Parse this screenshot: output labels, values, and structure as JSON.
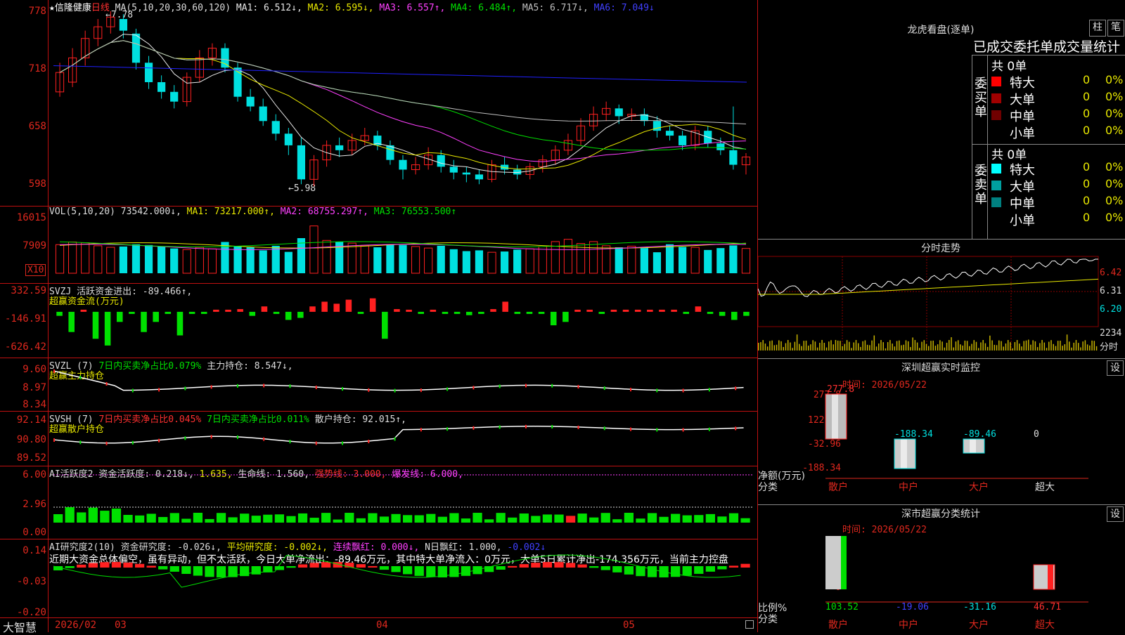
{
  "stock": {
    "name": "★信隆健康",
    "period": "日线"
  },
  "main_legend": {
    "ma": "MA(5,10,20,30,60,120)",
    "items": [
      {
        "label": "MA1: 6.512↓,",
        "color": "#e8e8e8"
      },
      {
        "label": "MA2: 6.595↓,",
        "color": "#e8e800"
      },
      {
        "label": "MA3: 6.557↑,",
        "color": "#ff40ff"
      },
      {
        "label": "MA4: 6.484↑,",
        "color": "#00e000"
      },
      {
        "label": "MA5: 6.717↓,",
        "color": "#c0c0c0"
      },
      {
        "label": "MA6: 7.049↓",
        "color": "#2020ff"
      }
    ],
    "high_mark": "7.78",
    "low_mark": "5.98"
  },
  "price_axis": [
    "778",
    "718",
    "658",
    "598"
  ],
  "colors": {
    "up": "#ff2020",
    "down": "#00e0e0",
    "axis": "#e0281e",
    "frame": "#c01010"
  },
  "vol": {
    "legend_prefix": "VOL(5,10,20)",
    "value": "73542.000↓,",
    "ma1": "MA1: 73217.000↑,",
    "ma2": "MA2: 68755.297↑,",
    "ma3": "MA3: 76553.500↑",
    "axis": [
      "16015",
      "7909"
    ],
    "unit": "X10"
  },
  "svzj": {
    "line1_prefix": "SVZJ",
    "line1_label": "活跃资金进出:",
    "line1_value": "-89.466↑,",
    "line2": "超赢资金流(万元)",
    "axis": [
      "332.59",
      "-146.91",
      "-626.42"
    ]
  },
  "svzl": {
    "prefix": "SVZL (7)",
    "ratio": "7日内买卖净占比0.079%",
    "hold": "主力持仓: 8.547↓,",
    "line2": "超赢主力持仓",
    "axis": [
      "9.60",
      "8.97",
      "8.34"
    ]
  },
  "svsh": {
    "prefix": "SVSH (7)",
    "ratio1": "7日内买卖净占比0.045%",
    "ratio2": "7日内买卖净占比0.011%",
    "hold": "散户持仓: 92.015↑,",
    "line2": "超赢散户持仓",
    "axis": [
      "92.14",
      "90.80",
      "89.52"
    ]
  },
  "ai_active": {
    "prefix": "AI活跃度2",
    "label": "资金活跃度: 0.218↓,",
    "v2": "1.635,",
    "life": "生命线: 1.560,",
    "strong": "强势线: 3.000,",
    "burst": "爆发线: 6.000,",
    "axis": [
      "6.00",
      "2.96",
      "0.00"
    ]
  },
  "ai_research": {
    "prefix": "AI研究度2(10)",
    "label": "资金研究度: -0.026↓,",
    "avg": "平均研究度: -0.002↓,",
    "streak": "连续飘红: 0.000↓,",
    "nday": "N日飘红: 1.000,",
    "last": "-0.002↓",
    "comment": "近期大资金总体偏空，虽有异动，但不太活跃，今日大单净流出：-89.46万元，其中特大单净流入：0万元，大单5日累计净出-174.356万元，当前主力控盘",
    "axis": [
      "0.14",
      "-0.03",
      "-0.20"
    ]
  },
  "date_axis": {
    "brand": "大智慧",
    "labels": [
      "2026/02",
      "03",
      "04",
      "05"
    ]
  },
  "dragon": {
    "title": "龙虎看盘(逐单)",
    "btn1": "柱",
    "btn2": "笔",
    "header": "已成交委托单成交量统计",
    "buy_side": "委买单",
    "sell_side": "委卖单",
    "buy_total": "共 0单",
    "sell_total": "共 0单",
    "buy_rows": [
      {
        "label": "特大",
        "count": "0",
        "pct": "0%",
        "color": "#ff0000"
      },
      {
        "label": "大单",
        "count": "0",
        "pct": "0%",
        "color": "#a00000"
      },
      {
        "label": "中单",
        "count": "0",
        "pct": "0%",
        "color": "#700000"
      },
      {
        "label": "小单",
        "count": "0",
        "pct": "0%",
        "color": "#000000"
      }
    ],
    "sell_rows": [
      {
        "label": "特大",
        "count": "0",
        "pct": "0%",
        "color": "#00ffff"
      },
      {
        "label": "大单",
        "count": "0",
        "pct": "0%",
        "color": "#00a0a0"
      },
      {
        "label": "中单",
        "count": "0",
        "pct": "0%",
        "color": "#008080"
      },
      {
        "label": "小单",
        "count": "0",
        "pct": "0%",
        "color": "#000000"
      }
    ]
  },
  "intraday": {
    "title": "分时走势",
    "price_axis": [
      "6.42",
      "6.31",
      "6.20"
    ],
    "vol_axis": "2234",
    "vol_label": "分时"
  },
  "sz_monitor": {
    "title": "深圳超赢实时监控",
    "setting": "设",
    "time": "时间: 2026/05/22",
    "axis": [
      "277.8",
      "122.42",
      "-32.96",
      "-188.34"
    ],
    "ylabel": "净额(万元)",
    "xlabel": "分类",
    "categories": [
      "散户",
      "中户",
      "大户",
      "超大"
    ],
    "value_labels": [
      "277.8",
      "-188.34",
      "-89.46",
      "0"
    ]
  },
  "sz_class": {
    "title": "深市超赢分类统计",
    "setting": "设",
    "time": "时间: 2026/05/22",
    "axis": [
      "75",
      "50",
      "25",
      "0"
    ],
    "ylabel": "比例%",
    "xlabel": "分类",
    "categories": [
      "散户",
      "中户",
      "大户",
      "超大"
    ],
    "value_labels": [
      "103.52",
      "-19.06",
      "-31.16",
      "46.71"
    ]
  },
  "chart_data": [
    {
      "type": "candlestick",
      "name": "日线",
      "ylim": [
        5.98,
        7.78
      ],
      "candles": [
        [
          6.95,
          7.15,
          7.25,
          6.9
        ],
        [
          7.05,
          7.3,
          7.4,
          7.0
        ],
        [
          7.3,
          7.5,
          7.58,
          7.22
        ],
        [
          7.5,
          7.62,
          7.7,
          7.42
        ],
        [
          7.62,
          7.72,
          7.78,
          7.55
        ],
        [
          7.7,
          7.58,
          7.75,
          7.5
        ],
        [
          7.55,
          7.25,
          7.6,
          7.18
        ],
        [
          7.25,
          7.05,
          7.32,
          6.98
        ],
        [
          7.05,
          6.95,
          7.12,
          6.88
        ],
        [
          6.95,
          6.85,
          7.02,
          6.78
        ],
        [
          6.85,
          7.1,
          7.15,
          6.8
        ],
        [
          7.1,
          7.3,
          7.38,
          7.05
        ],
        [
          7.3,
          7.4,
          7.45,
          7.22
        ],
        [
          7.4,
          7.2,
          7.45,
          7.15
        ],
        [
          7.2,
          6.9,
          7.25,
          6.85
        ],
        [
          6.9,
          6.8,
          6.98,
          6.75
        ],
        [
          6.8,
          6.65,
          6.88,
          6.6
        ],
        [
          6.65,
          6.52,
          6.72,
          6.45
        ],
        [
          6.52,
          6.4,
          6.58,
          6.3
        ],
        [
          6.4,
          6.05,
          6.48,
          6.0
        ],
        [
          6.05,
          6.25,
          6.3,
          5.98
        ],
        [
          6.25,
          6.4,
          6.45,
          6.18
        ],
        [
          6.4,
          6.35,
          6.48,
          6.28
        ],
        [
          6.35,
          6.45,
          6.52,
          6.3
        ],
        [
          6.45,
          6.5,
          6.58,
          6.4
        ],
        [
          6.5,
          6.4,
          6.55,
          6.35
        ],
        [
          6.4,
          6.25,
          6.45,
          6.2
        ],
        [
          6.25,
          6.15,
          6.3,
          6.05
        ],
        [
          6.15,
          6.2,
          6.28,
          6.1
        ],
        [
          6.2,
          6.3,
          6.38,
          6.15
        ],
        [
          6.3,
          6.18,
          6.35,
          6.12
        ],
        [
          6.18,
          6.12,
          6.25,
          6.05
        ],
        [
          6.12,
          6.1,
          6.18,
          6.02
        ],
        [
          6.1,
          6.05,
          6.15,
          6.0
        ],
        [
          6.05,
          6.2,
          6.25,
          6.02
        ],
        [
          6.2,
          6.15,
          6.28,
          6.1
        ],
        [
          6.15,
          6.1,
          6.2,
          6.05
        ],
        [
          6.1,
          6.18,
          6.22,
          6.05
        ],
        [
          6.18,
          6.25,
          6.3,
          6.12
        ],
        [
          6.25,
          6.35,
          6.4,
          6.2
        ],
        [
          6.35,
          6.45,
          6.52,
          6.3
        ],
        [
          6.45,
          6.6,
          6.68,
          6.4
        ],
        [
          6.6,
          6.72,
          6.8,
          6.55
        ],
        [
          6.72,
          6.78,
          6.85,
          6.65
        ],
        [
          6.78,
          6.7,
          6.82,
          6.62
        ],
        [
          6.7,
          6.72,
          6.78,
          6.65
        ],
        [
          6.72,
          6.65,
          6.78,
          6.6
        ],
        [
          6.65,
          6.55,
          6.7,
          6.48
        ],
        [
          6.55,
          6.5,
          6.6,
          6.45
        ],
        [
          6.5,
          6.4,
          6.55,
          6.35
        ],
        [
          6.4,
          6.55,
          6.6,
          6.35
        ],
        [
          6.55,
          6.42,
          6.6,
          6.38
        ],
        [
          6.42,
          6.35,
          6.48,
          6.3
        ],
        [
          6.35,
          6.2,
          6.8,
          6.15
        ],
        [
          6.2,
          6.28,
          6.32,
          6.1
        ]
      ]
    },
    {
      "type": "bar",
      "name": "VOL(5,10,20)",
      "values": [
        7500,
        8200,
        8000,
        7200,
        6800,
        7000,
        7600,
        7400,
        7000,
        6500,
        6200,
        6800,
        6400,
        8200,
        7000,
        6800,
        6000,
        7200,
        5600,
        9200,
        12400,
        8600,
        8200,
        7900,
        7300,
        6800,
        7600,
        7400,
        7000,
        6600,
        7200,
        6300,
        5800,
        6000,
        5500,
        5700,
        6200,
        6400,
        7000,
        8300,
        8900,
        7800,
        8300,
        7200,
        6800,
        7100,
        6600,
        5500,
        7600,
        6900,
        6800,
        6100,
        6600,
        7300,
        6500
      ],
      "ylim": [
        0,
        16015
      ]
    },
    {
      "type": "bar",
      "name": "超赢资金流(万元)",
      "values": [
        -60,
        -300,
        20,
        -400,
        -500,
        -150,
        -30,
        -300,
        -150,
        -30,
        -350,
        -20,
        -30,
        0,
        0,
        40,
        -60,
        80,
        -20,
        -120,
        -90,
        80,
        150,
        120,
        180,
        -20,
        200,
        -400,
        40,
        0,
        -10,
        0,
        -10,
        -20,
        -50,
        -10,
        40,
        150,
        -20,
        -20,
        -20,
        -200,
        -150,
        0,
        30,
        -10,
        0,
        0,
        0,
        0,
        0,
        30,
        -20,
        80,
        -20,
        -60,
        -120,
        -60
      ],
      "ylim": [
        -626.42,
        332.59
      ]
    }
  ]
}
